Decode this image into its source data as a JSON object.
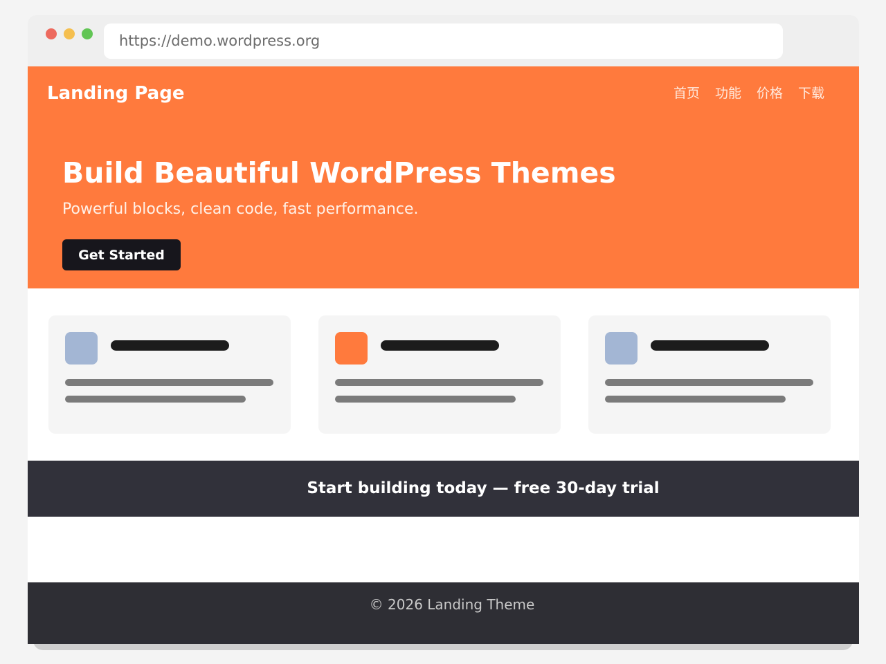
{
  "browser": {
    "url": "https://demo.wordpress.org"
  },
  "header": {
    "brand": "Landing Page",
    "nav": [
      {
        "label": "首页"
      },
      {
        "label": "功能"
      },
      {
        "label": "价格"
      },
      {
        "label": "下载"
      }
    ]
  },
  "hero": {
    "title": "Build Beautiful WordPress Themes",
    "subtitle": "Powerful blocks, clean code, fast performance.",
    "cta_label": "Get Started"
  },
  "cards": [
    {
      "icon": "blue-square-icon",
      "icon_color": "#a3b6d4"
    },
    {
      "icon": "orange-square-icon",
      "icon_color": "#ff7a3d"
    },
    {
      "icon": "blue-square-icon",
      "icon_color": "#a3b6d4"
    }
  ],
  "banner": {
    "text": "Start building today — free 30-day trial"
  },
  "footer": {
    "text": "© 2026 Landing Theme"
  },
  "colors": {
    "accent": "#ff7a3d",
    "dark": "#17161c",
    "banner_bg": "#31313a",
    "footer_bg": "#2e2e34"
  }
}
